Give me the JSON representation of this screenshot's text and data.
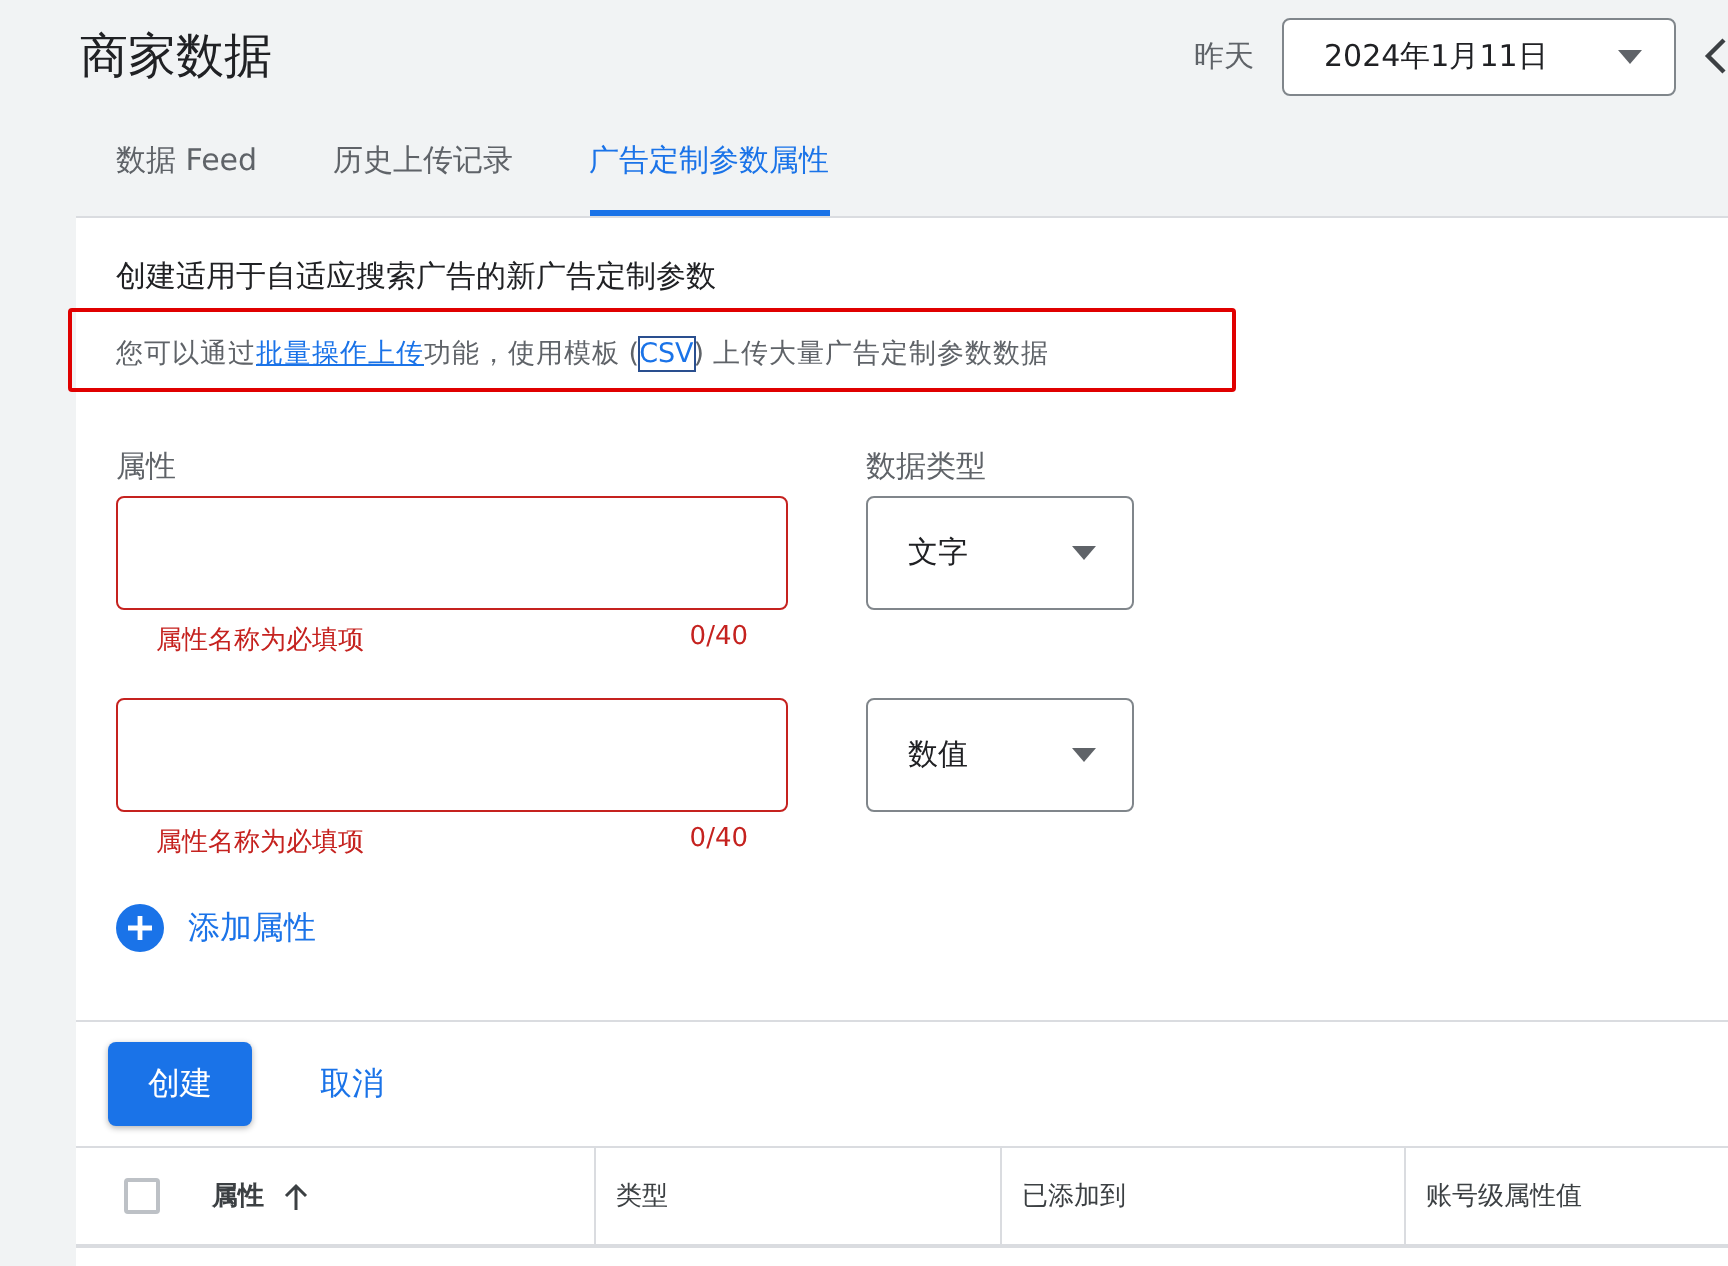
{
  "header": {
    "title": "商家数据",
    "date_label": "昨天",
    "date_value": "2024年1月11日"
  },
  "tabs": [
    {
      "label": "数据 Feed",
      "selected": false
    },
    {
      "label": "历史上传记录",
      "selected": false
    },
    {
      "label": "广告定制参数属性",
      "selected": true
    }
  ],
  "form": {
    "heading": "创建适用于自适应搜索广告的新广告定制参数",
    "notice": {
      "highlighted": true,
      "before": "您可以通过",
      "link": "批量操作上传",
      "middle": "功能，使用模板 (",
      "template_link": "CSV",
      "template_focused": true,
      "after": ") 上传大量广告定制参数数据"
    },
    "attribute_label": "属性",
    "type_label": "数据类型",
    "rows": [
      {
        "value": "",
        "error": true,
        "helper": "属性名称为必填项",
        "counter": "0/40",
        "type": "文字"
      },
      {
        "value": "",
        "error": true,
        "helper": "属性名称为必填项",
        "counter": "0/40",
        "type": "数值"
      }
    ],
    "add_label": "添加属性"
  },
  "actions": {
    "primary": "创建",
    "secondary": "取消"
  },
  "table": {
    "select_all_checked": false,
    "columns": [
      {
        "label": "属性",
        "sorted": true
      },
      {
        "label": "类型",
        "sorted": false
      },
      {
        "label": "已添加到",
        "sorted": false
      },
      {
        "label": "账号级属性值",
        "sorted": false
      }
    ]
  }
}
